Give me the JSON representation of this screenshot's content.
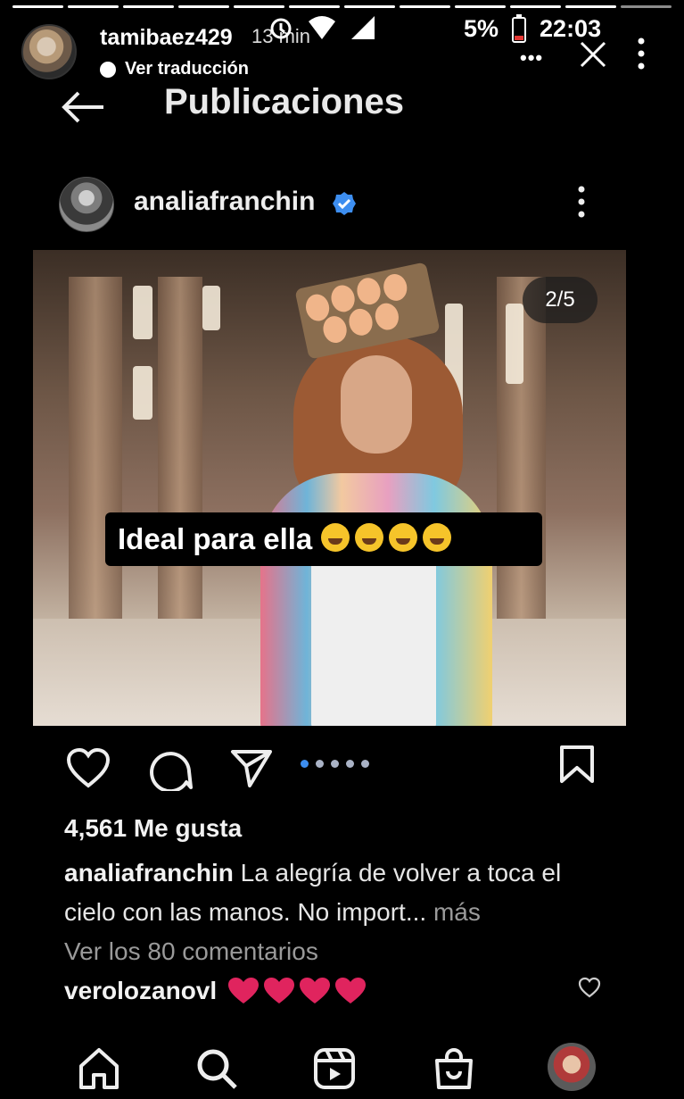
{
  "story": {
    "username": "tamibaez429",
    "time_ago": "13 min",
    "translate_label": "Ver traducción",
    "progress_segments": 12
  },
  "status_bar": {
    "battery": "5%",
    "time": "22:03"
  },
  "header": {
    "title": "Publicaciones"
  },
  "post": {
    "username": "analiafranchin",
    "slide_counter": "2/5",
    "image_caption": "Ideal para ella",
    "image_caption_emoji_count": 4,
    "likes": "4,561 Me gusta",
    "caption_user": "analiafranchin",
    "caption_text": " La alegría de volver a toca el cielo con las manos. No import...",
    "caption_more": " más",
    "comments_link": "Ver los 80 comentarios",
    "comment": {
      "user": "verolozanovl",
      "heart_count": 4
    },
    "carousel_dots": 5,
    "carousel_active": 0
  },
  "colors": {
    "background": "#000000",
    "verified": "#3d8ef0",
    "heart": "#e0245e",
    "muted_text": "#9a9a9a"
  },
  "icons": [
    "back-arrow-icon",
    "close-icon",
    "kebab-icon",
    "verified-icon",
    "like-icon",
    "comment-icon",
    "share-icon",
    "bookmark-icon",
    "home-icon",
    "search-icon",
    "reels-icon",
    "shop-icon"
  ]
}
